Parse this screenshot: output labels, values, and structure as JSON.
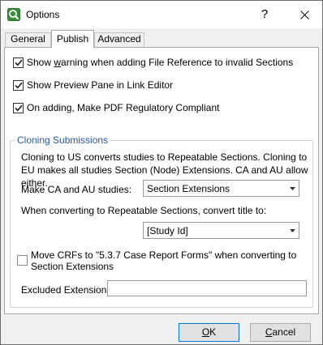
{
  "window": {
    "title": "Options",
    "help_glyph": "?",
    "close_icon": "close-icon"
  },
  "tabs": [
    {
      "label": "General",
      "active": false
    },
    {
      "label": "Publish",
      "active": true
    },
    {
      "label": "Advanced",
      "active": false
    }
  ],
  "publish": {
    "checkboxes": [
      {
        "label_pre": "Show ",
        "label_ul": "w",
        "label_post": "arning when adding File Reference to invalid Sections",
        "checked": true
      },
      {
        "label_pre": "Show Preview Pane in Link Editor",
        "label_ul": "",
        "label_post": "",
        "checked": true
      },
      {
        "label_pre": "On adding, Make PDF Regulatory Compliant",
        "label_ul": "",
        "label_post": "",
        "checked": true
      }
    ],
    "cloning": {
      "legend": "Cloning Submissions",
      "description": "Cloning to US converts studies to Repeatable Sections.  Cloning to EU makes all studies Section (Node) Extensions.  CA and AU allow either.",
      "ca_au_label": "Make CA and AU studies:",
      "ca_au_value": "Section Extensions",
      "convert_label": "When converting to Repeatable Sections, convert title to:",
      "convert_value": "[Study Id]",
      "move_crfs_label": "Move CRFs to \"5.3.7 Case Report Forms\" when converting to Section Extensions",
      "move_crfs_checked": false,
      "excluded_label": "Excluded Extensions",
      "excluded_value": ""
    }
  },
  "buttons": {
    "ok_ul": "O",
    "ok_rest": "K",
    "cancel_ul": "C",
    "cancel_rest": "ancel"
  },
  "colors": {
    "legend_text": "#2c58a3",
    "default_button_border": "#0078d7",
    "checkbox_border": "#333333"
  }
}
